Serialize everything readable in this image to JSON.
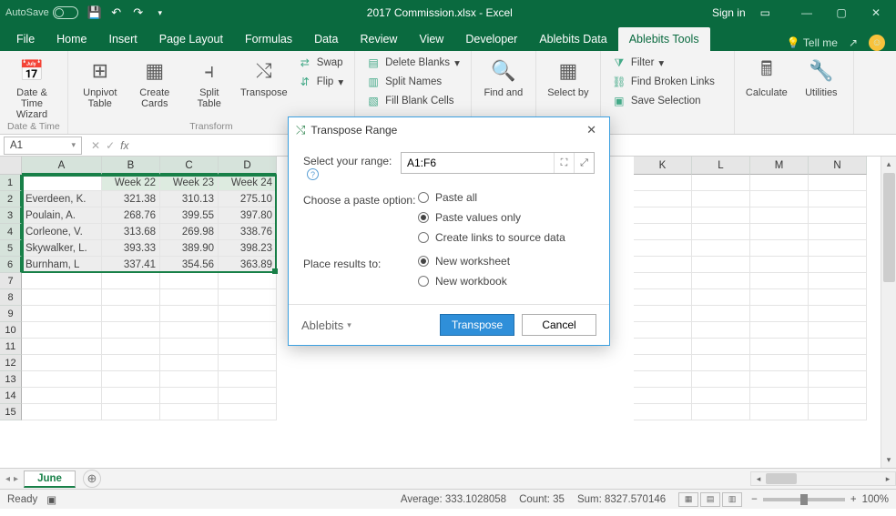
{
  "titlebar": {
    "autosave_label": "AutoSave",
    "title": "2017 Commission.xlsx - Excel",
    "signin": "Sign in"
  },
  "tabs": {
    "file": "File",
    "home": "Home",
    "insert": "Insert",
    "page_layout": "Page Layout",
    "formulas": "Formulas",
    "data": "Data",
    "review": "Review",
    "view": "View",
    "developer": "Developer",
    "ablebits_data": "Ablebits Data",
    "ablebits_tools": "Ablebits Tools",
    "tell_me": "Tell me"
  },
  "ribbon": {
    "date_time": {
      "date_time_wizard": "Date &\nTime Wizard",
      "group": "Date & Time"
    },
    "transform": {
      "unpivot": "Unpivot\nTable",
      "create_cards": "Create\nCards",
      "split_table": "Split\nTable",
      "transpose": "Transpose",
      "swap": "Swap",
      "flip": "Flip",
      "delete_blanks": "Delete Blanks",
      "split_names": "Split Names",
      "fill_blank": "Fill Blank Cells",
      "group": "Transform"
    },
    "find": {
      "find_and": "Find and"
    },
    "select": {
      "select_by": "Select by"
    },
    "links": {
      "filter": "Filter",
      "find_broken": "Find Broken Links",
      "save_selection": "Save Selection"
    },
    "calc": {
      "calculate": "Calculate",
      "utilities": "Utilities"
    }
  },
  "formula_bar": {
    "name_box": "A1",
    "fx": "fx"
  },
  "columns_sel": [
    "A",
    "B",
    "C",
    "D"
  ],
  "columns_rest": [
    "K",
    "L",
    "M",
    "N"
  ],
  "row_numbers": [
    1,
    2,
    3,
    4,
    5,
    6,
    7,
    8,
    9,
    10,
    11,
    12,
    13,
    14,
    15
  ],
  "chart_data": {
    "type": "table",
    "headers": [
      "",
      "Week 22",
      "Week 23",
      "Week 24"
    ],
    "rows": [
      [
        "Everdeen, K.",
        321.38,
        310.13,
        275.1
      ],
      [
        "Poulain, A.",
        268.76,
        399.55,
        397.8
      ],
      [
        "Corleone, V.",
        313.68,
        269.98,
        338.76
      ],
      [
        "Skywalker, L.",
        393.33,
        389.9,
        398.23
      ],
      [
        "Burnham, L",
        337.41,
        354.56,
        363.89
      ]
    ]
  },
  "dialog": {
    "title": "Transpose Range",
    "select_range": "Select your range:",
    "range_value": "A1:F6",
    "choose_paste": "Choose a paste option:",
    "paste_all": "Paste all",
    "paste_values": "Paste values only",
    "create_links": "Create links to source data",
    "place_results": "Place results to:",
    "new_worksheet": "New worksheet",
    "new_workbook": "New workbook",
    "brand": "Ablebits",
    "transpose_btn": "Transpose",
    "cancel_btn": "Cancel"
  },
  "sheet": {
    "active": "June"
  },
  "status": {
    "ready": "Ready",
    "average": "Average: 333.1028058",
    "count": "Count: 35",
    "sum": "Sum: 8327.570146",
    "zoom": "100%"
  }
}
